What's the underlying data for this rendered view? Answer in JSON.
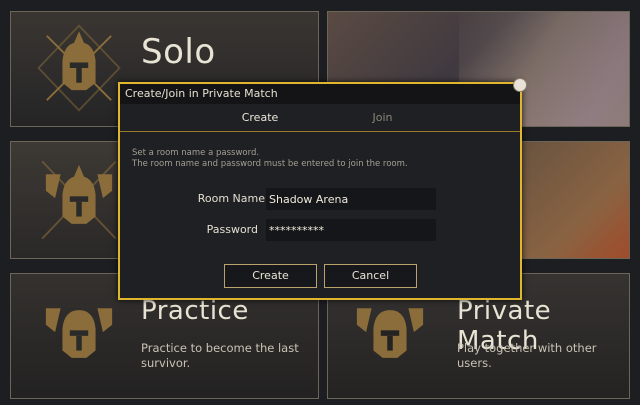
{
  "modes": {
    "solo": {
      "title": "Solo"
    },
    "practice": {
      "title": "Practice",
      "description": "Practice to become the last survivor."
    },
    "private": {
      "title": "Private Match",
      "description": "Play together with other users."
    }
  },
  "dialog": {
    "title": "Create/Join in Private Match",
    "tabs": [
      {
        "label": "Create",
        "active": true
      },
      {
        "label": "Join",
        "active": false
      }
    ],
    "info_line1": "Set a room name a password.",
    "info_line2": "The room name and password must be entered to join the room.",
    "room_name_label": "Room Name",
    "room_name_value": "Shadow Arena",
    "password_label": "Password",
    "password_value": "**********",
    "create_button": "Create",
    "cancel_button": "Cancel"
  },
  "colors": {
    "accent_gold": "#e0b62f",
    "emblem_gold": "#8a6d3a"
  },
  "icons": [
    "warrior-helmet-crossed-swords-emblem",
    "warrior-helmet-banners-emblem",
    "close-icon"
  ]
}
